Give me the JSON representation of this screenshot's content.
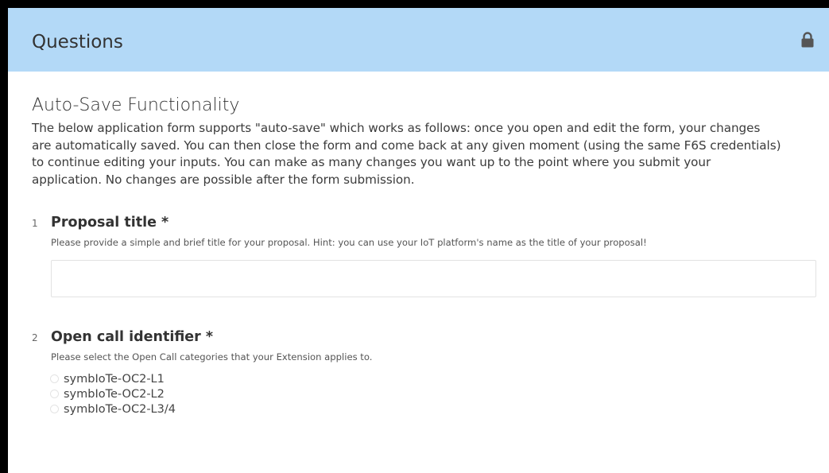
{
  "header": {
    "title": "Questions",
    "icon": "lock-icon"
  },
  "intro": {
    "title": "Auto-Save Functionality",
    "lines": [
      "The below application form supports \"auto-save\" which works as follows: once you open and edit the form, your changes",
      "are automatically saved. You can then close the form and come back at any given moment (using the same F6S credentials)",
      "to continue editing your inputs. You can make as many changes you want up to the point where you submit your",
      "application. No changes are possible after the form submission."
    ]
  },
  "questions": [
    {
      "number": "1",
      "title": "Proposal title *",
      "hint": "Please provide a simple and brief title for your proposal. Hint: you can use your IoT platform's name as the title of your proposal!",
      "value": ""
    },
    {
      "number": "2",
      "title": "Open call identifier *",
      "hint": "Please select the Open Call categories that your Extension applies to.",
      "options": [
        "symbIoTe-OC2-L1",
        "symbIoTe-OC2-L2",
        "symbIoTe-OC2-L3/4"
      ]
    }
  ],
  "colors": {
    "header_bg": "#b3d9f7",
    "frame": "#000000"
  }
}
